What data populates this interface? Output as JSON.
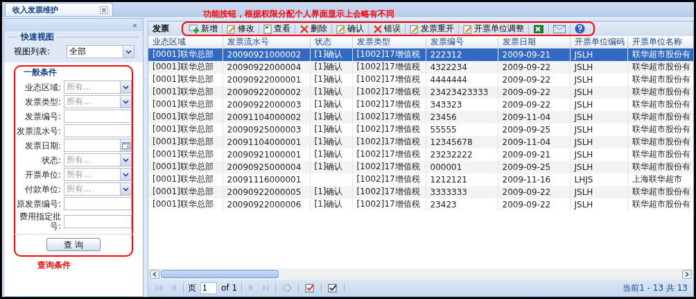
{
  "tab": {
    "title": "收入发票维护",
    "close": "×"
  },
  "left_panel": {
    "collapse": "«",
    "quick_view": {
      "legend": "快速视图",
      "label": "视图列表:",
      "value": "全部"
    },
    "general": {
      "legend": "一般条件",
      "fields": [
        {
          "label": "业态区域:",
          "kind": "select",
          "placeholder": "所有..."
        },
        {
          "label": "发票类型:",
          "kind": "select",
          "placeholder": "所有..."
        },
        {
          "label": "发票编号:",
          "kind": "text"
        },
        {
          "label": "发票流水号:",
          "kind": "text"
        },
        {
          "label": "发票日期:",
          "kind": "date"
        },
        {
          "label": "状态:",
          "kind": "select",
          "placeholder": "所有..."
        },
        {
          "label": "开票单位:",
          "kind": "select",
          "placeholder": "所有..."
        },
        {
          "label": "付款单位:",
          "kind": "select",
          "placeholder": "所有..."
        },
        {
          "label": "原发票编号:",
          "kind": "text"
        },
        {
          "label": "费用指定批号:",
          "kind": "text"
        }
      ]
    },
    "query_button": "查 询",
    "annotation": "查询条件"
  },
  "grid": {
    "title": "发票",
    "annotation": "功能按钮，根据权限分配个人界面显示上会略有不同",
    "toolbar": [
      {
        "kind": "add",
        "label": "新增"
      },
      {
        "kind": "edit",
        "label": "修改"
      },
      {
        "kind": "view",
        "label": "查看"
      },
      {
        "kind": "delete",
        "label": "删除"
      },
      {
        "kind": "edit",
        "label": "确认"
      },
      {
        "kind": "delete",
        "label": "错误"
      },
      {
        "kind": "edit",
        "label": "发票重开"
      },
      {
        "kind": "edit",
        "label": "开票单位调整"
      },
      {
        "kind": "excel"
      },
      {
        "kind": "mail"
      },
      {
        "kind": "help"
      }
    ],
    "columns": [
      "业态区域",
      "发票流水号",
      "状态",
      "发票类型",
      "发票编号",
      "发票日期",
      "开票单位编码",
      "开票单位名称"
    ],
    "rows": [
      {
        "selected": true,
        "cells": [
          "[0001]联华总部",
          "20090921000002",
          "[1]确认",
          "[1002]17增值税",
          "222312",
          "2009-09-21",
          "JSLH",
          "联华超市股份有"
        ]
      },
      {
        "selected": false,
        "cells": [
          "[0001]联华总部",
          "20090922000004",
          "[1]确认",
          "[1002]17增值税",
          "4322234",
          "2009-09-22",
          "JSLH",
          "联华超市股份有"
        ]
      },
      {
        "selected": false,
        "cells": [
          "[0001]联华总部",
          "20090922000001",
          "[1]确认",
          "[1002]17增值税",
          "4444444",
          "2009-09-22",
          "JSLH",
          "联华超市股份有"
        ]
      },
      {
        "selected": false,
        "cells": [
          "[0001]联华总部",
          "20090922000002",
          "[1]确认",
          "[1002]17增值税",
          "23423423333",
          "2009-09-22",
          "JSLH",
          "联华超市股份有"
        ]
      },
      {
        "selected": false,
        "cells": [
          "[0001]联华总部",
          "20090922000003",
          "[1]确认",
          "[1002]17增值税",
          "343323",
          "2009-09-22",
          "JSLH",
          "联华超市股份有"
        ]
      },
      {
        "selected": false,
        "cells": [
          "[0001]联华总部",
          "20091104000002",
          "[1]确认",
          "[1002]17增值税",
          "23456",
          "2009-11-04",
          "JSLH",
          "联华超市股份有"
        ]
      },
      {
        "selected": false,
        "cells": [
          "[0001]联华总部",
          "20090925000003",
          "[1]确认",
          "[1002]17增值税",
          "55555",
          "2009-09-25",
          "JSLH",
          "联华超市股份有"
        ]
      },
      {
        "selected": false,
        "cells": [
          "[0001]联华总部",
          "20091104000001",
          "[1]确认",
          "[1002]17增值税",
          "12345678",
          "2009-11-04",
          "JSLH",
          "联华超市股份有"
        ]
      },
      {
        "selected": false,
        "cells": [
          "[0001]联华总部",
          "20090921000001",
          "[1]确认",
          "[1002]17增值税",
          "23232222",
          "2009-09-21",
          "JSLH",
          "联华超市股份有"
        ]
      },
      {
        "selected": false,
        "cells": [
          "[0001]联华总部",
          "20090925000004",
          "[1]确认",
          "[1002]17增值税",
          "000001",
          "2009-09-25",
          "JSLH",
          "联华超市股份有"
        ]
      },
      {
        "selected": false,
        "cells": [
          "[0001]联华总部",
          "20091116000001",
          "",
          "[1002]17增值税",
          "1212121",
          "2009-11-16",
          "LHJS",
          "上海联华超市"
        ]
      },
      {
        "selected": false,
        "cells": [
          "[0001]联华总部",
          "20090922000005",
          "[1]确认",
          "[1002]17增值税",
          "3333333",
          "2009-09-22",
          "JSLH",
          "联华超市股份有"
        ]
      },
      {
        "selected": false,
        "cells": [
          "[0001]联华总部",
          "20090922000006",
          "[1]确认",
          "[1002]17增值税",
          "23423",
          "2009-09-22",
          "JSLH",
          "联华超市股份有"
        ]
      }
    ],
    "pager": {
      "first_disabled": true,
      "prev_disabled": true,
      "page_label": "页",
      "page": "1",
      "of": "of 1",
      "next_disabled": true,
      "last_disabled": true,
      "summary": "当前1 - 13 共 13"
    }
  }
}
